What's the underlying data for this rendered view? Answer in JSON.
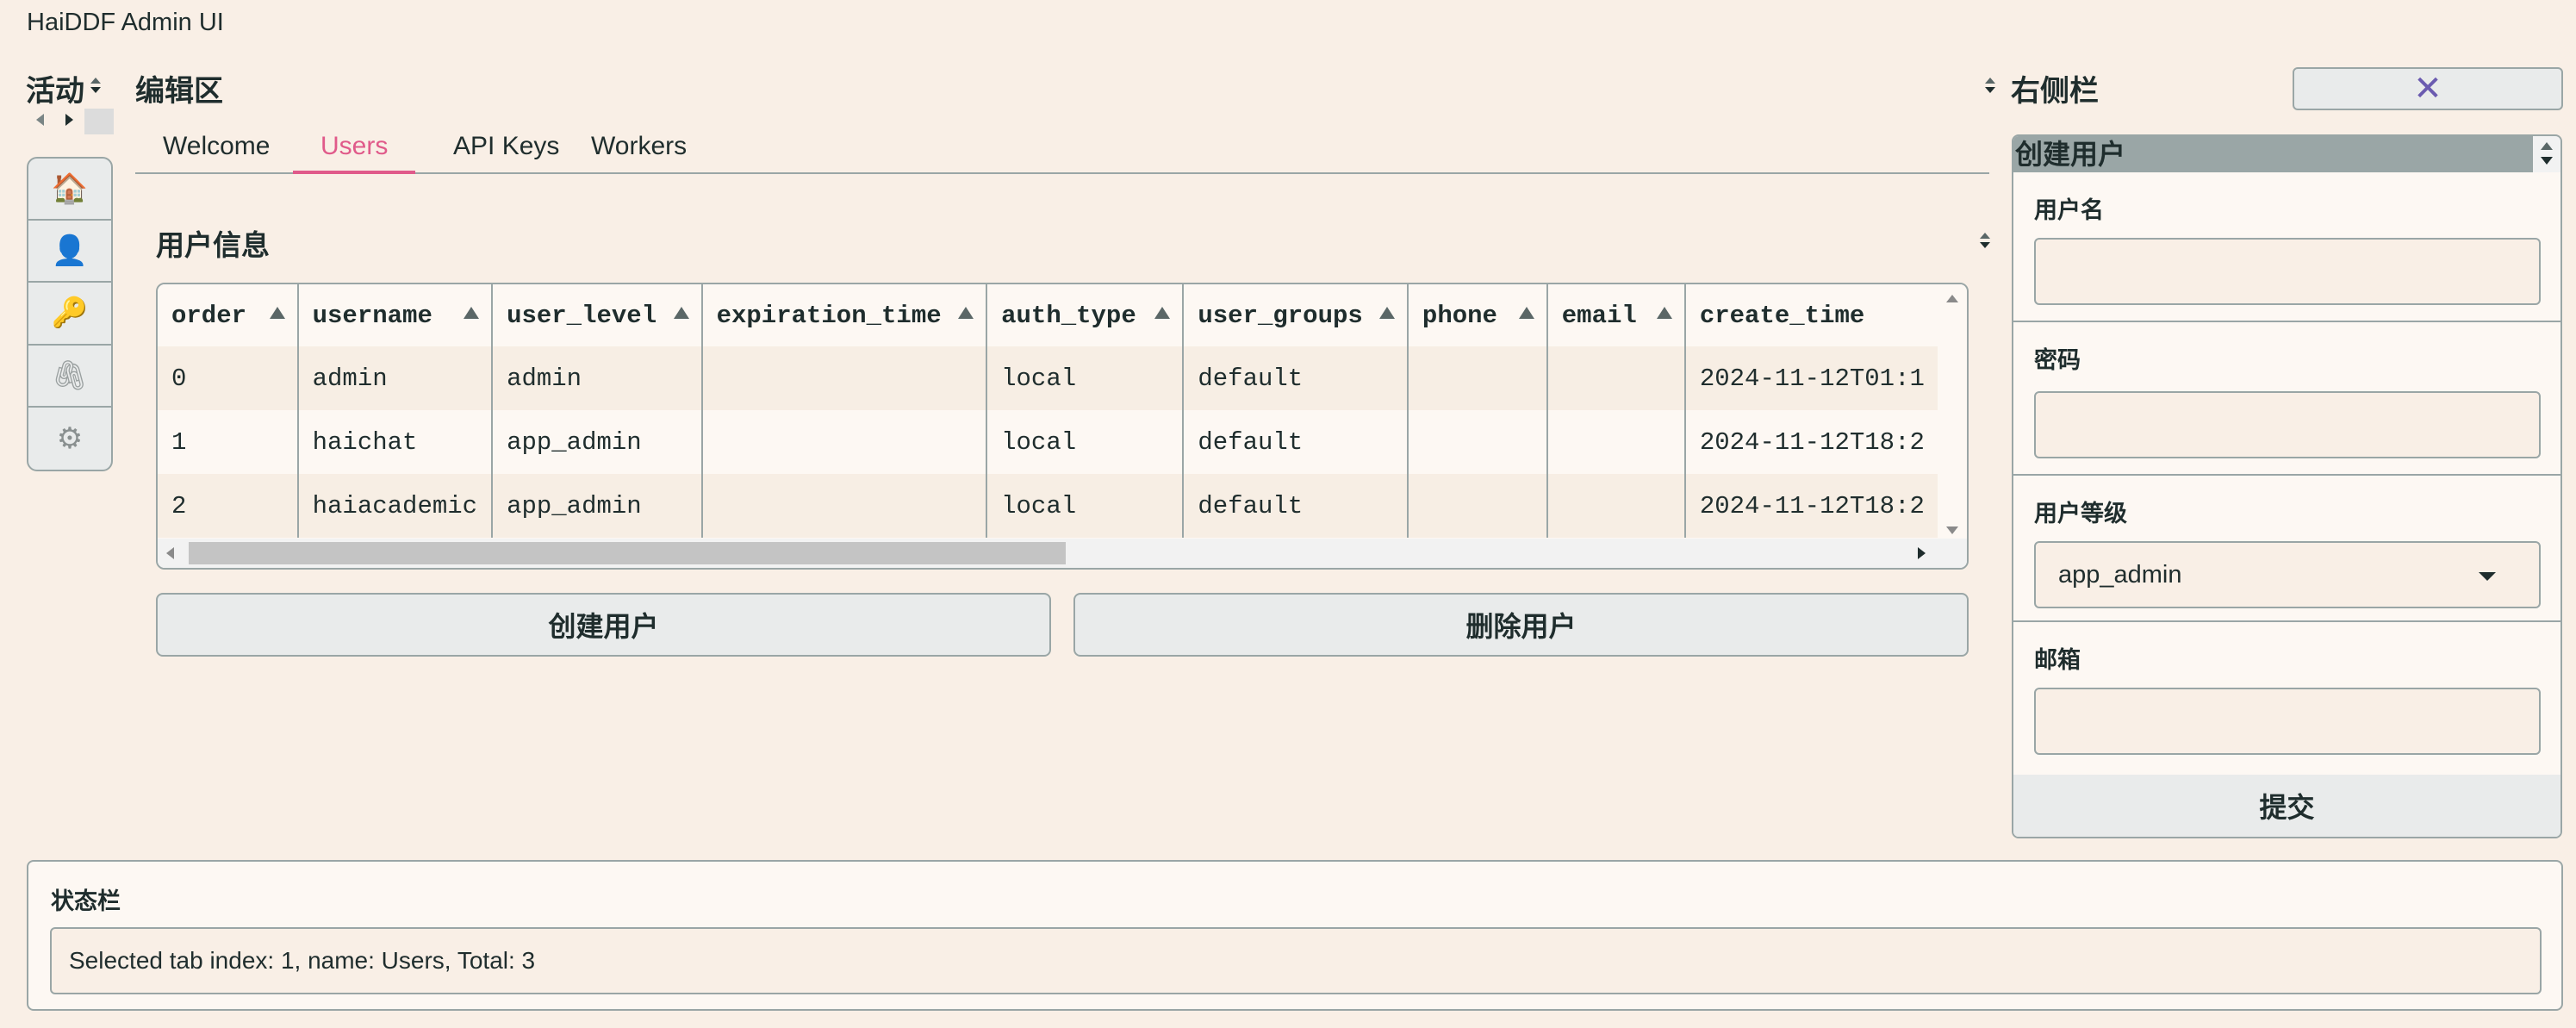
{
  "app": {
    "title": "HaiDDF Admin UI"
  },
  "activity": {
    "title": "活动",
    "items": [
      {
        "name": "home",
        "glyph": "🏠"
      },
      {
        "name": "user",
        "glyph": "👤"
      },
      {
        "name": "key",
        "glyph": "🔑"
      },
      {
        "name": "worker",
        "glyph": "🖇"
      },
      {
        "name": "settings",
        "glyph": "⚙"
      }
    ]
  },
  "editor": {
    "title": "编辑区",
    "tabs": [
      "Welcome",
      "Users",
      "API Keys",
      "Workers"
    ],
    "active_tab": "Users",
    "section_title": "用户信息",
    "table": {
      "columns": [
        "order",
        "username",
        "user_level",
        "expiration_time",
        "auth_type",
        "user_groups",
        "phone",
        "email",
        "create_time"
      ],
      "rows": [
        [
          "0",
          "admin",
          "admin",
          "",
          "local",
          "default",
          "",
          "",
          "2024-11-12T01:1"
        ],
        [
          "1",
          "haichat",
          "app_admin",
          "",
          "local",
          "default",
          "",
          "",
          "2024-11-12T18:2"
        ],
        [
          "2",
          "haiacademic",
          "app_admin",
          "",
          "local",
          "default",
          "",
          "",
          "2024-11-12T18:2"
        ]
      ]
    },
    "buttons": {
      "create": "创建用户",
      "delete": "删除用户"
    }
  },
  "right_sidebar": {
    "title": "右侧栏",
    "close_label": "✕",
    "form": {
      "title": "创建用户",
      "username_label": "用户名",
      "username_value": "",
      "password_label": "密码",
      "password_value": "",
      "level_label": "用户等级",
      "level_value": "app_admin",
      "email_label": "邮箱",
      "email_value": "",
      "submit_label": "提交"
    }
  },
  "status_bar": {
    "title": "状态栏",
    "message": "Selected tab index: 1, name: Users, Total: 3"
  },
  "colors": {
    "background": "#f9efe6",
    "accent": "#e05a8a",
    "border": "#9aa6a6",
    "close_icon": "#6b5bb0"
  }
}
